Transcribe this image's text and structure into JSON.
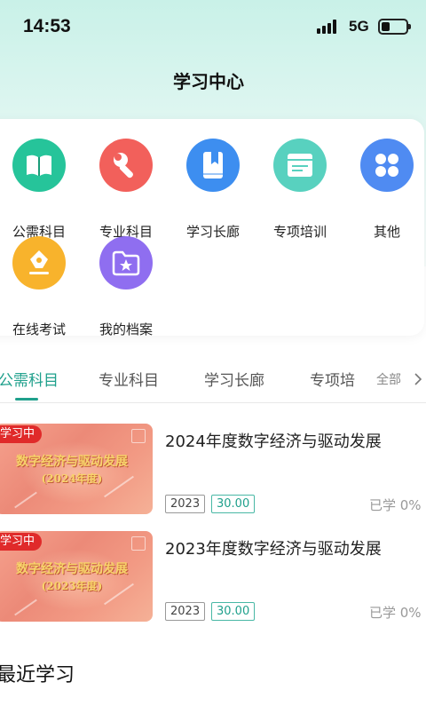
{
  "status": {
    "time": "14:53",
    "network": "5G"
  },
  "header": {
    "title": "学习中心"
  },
  "menu": {
    "items": [
      {
        "label": "公需科目",
        "icon": "book-icon",
        "color": "#26c49a"
      },
      {
        "label": "专业科目",
        "icon": "wrench-icon",
        "color": "#f2605b"
      },
      {
        "label": "学习长廊",
        "icon": "bookmark-book-icon",
        "color": "#3d8ef0"
      },
      {
        "label": "专项培训",
        "icon": "browser-window-icon",
        "color": "#58d1bf"
      },
      {
        "label": "其他",
        "icon": "grid-icon",
        "color": "#4f8bf2"
      },
      {
        "label": "在线考试",
        "icon": "pen-nib-icon",
        "color": "#f8b32c"
      },
      {
        "label": "我的档案",
        "icon": "star-folder-icon",
        "color": "#8f6ef0"
      }
    ]
  },
  "tabs": {
    "items": [
      "公需科目",
      "专业科目",
      "学习长廊",
      "专项培"
    ],
    "active_index": 0,
    "more_label": "全部",
    "accent": "#1fa08c"
  },
  "courses": [
    {
      "badge": "学习中",
      "thumb_title": "数字经济与驱动发展",
      "thumb_subtitle": "(2024年度)",
      "title": "2024年度数字经济与驱动发展",
      "year_tag": "2023",
      "hours_tag": "30.00",
      "progress": "已学 0%"
    },
    {
      "badge": "学习中",
      "thumb_title": "数字经济与驱动发展",
      "thumb_subtitle": "(2023年度)",
      "title": "2023年度数字经济与驱动发展",
      "year_tag": "2023",
      "hours_tag": "30.00",
      "progress": "已学 0%"
    }
  ],
  "recent": {
    "title": "最近学习"
  }
}
